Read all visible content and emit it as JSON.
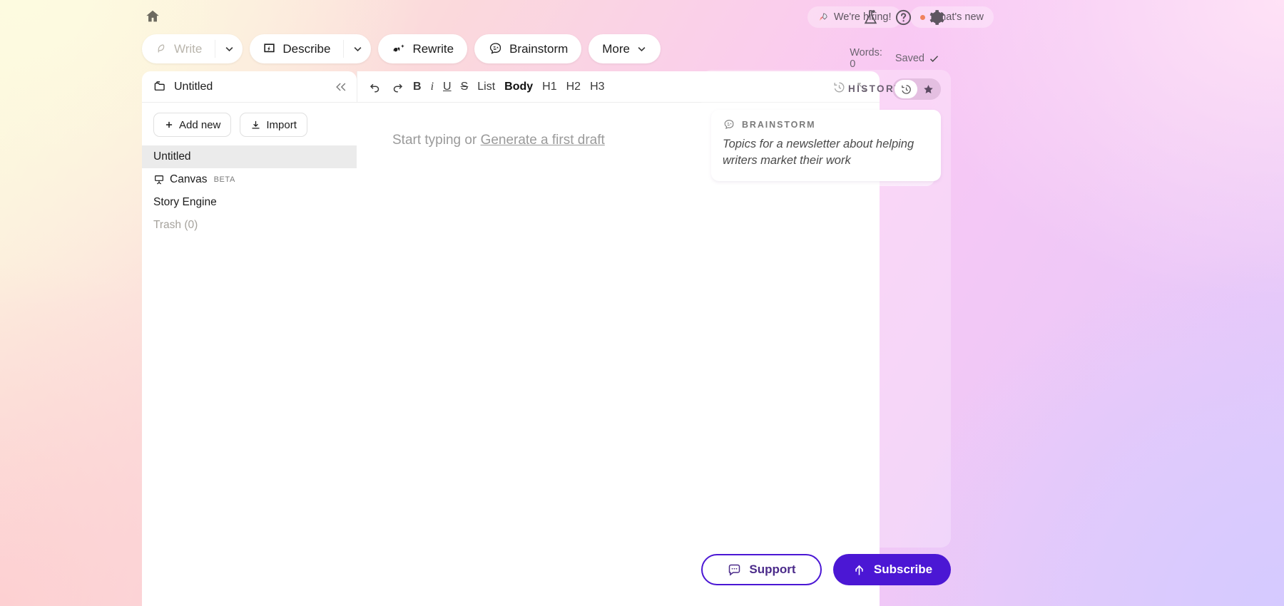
{
  "topbar": {
    "home_icon": "home-icon",
    "tools": [
      {
        "label": "Write",
        "icon": "feather-icon",
        "has_caret": true,
        "disabled": true
      },
      {
        "label": "Describe",
        "icon": "describe-icon",
        "has_caret": true,
        "disabled": false
      },
      {
        "label": "Rewrite",
        "icon": "rewrite-icon",
        "has_caret": false,
        "disabled": false
      },
      {
        "label": "Brainstorm",
        "icon": "brain-icon",
        "has_caret": false,
        "disabled": false
      },
      {
        "label": "More",
        "icon": "",
        "has_caret": true,
        "disabled": false
      }
    ],
    "hiring_chip": "We're hiring!",
    "whats_new_chip": "What's new",
    "lab_icon": "flask-icon",
    "help_icon": "help-circle-icon",
    "settings_icon": "gear-icon",
    "words_label": "Words: 0",
    "saved_label": "Saved"
  },
  "sidebar": {
    "folder_icon": "folder-icon",
    "title": "Untitled",
    "collapse_icon": "chevrons-left-icon",
    "add_new_label": "Add new",
    "import_label": "Import",
    "items": [
      {
        "label": "Untitled",
        "icon": "",
        "badge": "",
        "active": true,
        "muted": false
      },
      {
        "label": "Canvas",
        "icon": "easel-icon",
        "badge": "BETA",
        "active": false,
        "muted": false
      },
      {
        "label": "Story Engine",
        "icon": "",
        "badge": "",
        "active": false,
        "muted": false
      },
      {
        "label": "Trash (0)",
        "icon": "",
        "badge": "",
        "active": false,
        "muted": true
      }
    ]
  },
  "editor": {
    "toolbar": {
      "undo_icon": "undo-icon",
      "redo_icon": "redo-icon",
      "bold": "B",
      "italic": "i",
      "underline": "U",
      "strike": "S",
      "list": "List",
      "body": "Body",
      "h1": "H1",
      "h2": "H2",
      "h3": "H3",
      "history_icon": "clock-history-icon",
      "expand_icon": "expand-icon"
    },
    "placeholder_prefix": "Start typing or ",
    "placeholder_link": "Generate a first draft"
  },
  "history": {
    "title": "HISTORY",
    "toggle_history_icon": "clock-history-icon",
    "toggle_star_icon": "star-icon",
    "cards": [
      {
        "icon": "brain-icon",
        "label": "BRAINSTORM",
        "text": "Topics for a newsletter about helping writers market their work"
      }
    ]
  },
  "footer": {
    "support_label": "Support",
    "support_icon": "chat-dots-icon",
    "subscribe_label": "Subscribe",
    "subscribe_icon": "arrow-up-icon"
  },
  "colors": {
    "accent": "#4b17d4",
    "notice_dot": "#f0825c",
    "active_row": "#ebebeb"
  }
}
